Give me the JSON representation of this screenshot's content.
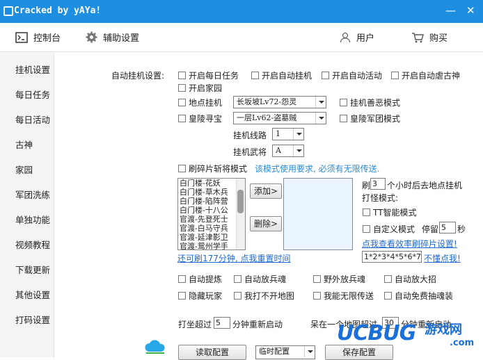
{
  "titlebar": {
    "title": "Cracked by yAYa!",
    "min": "—",
    "close": "✕"
  },
  "toolbar": {
    "console": "控制台",
    "assist": "辅助设置",
    "user": "用户",
    "buy": "购买"
  },
  "sidebar": {
    "items": [
      "挂机设置",
      "每日任务",
      "每日活动",
      "古神",
      "家园",
      "军团洗练",
      "单独功能",
      "视频教程",
      "下载更新",
      "其他设置",
      "打码设置"
    ]
  },
  "settings": {
    "heading": "自动挂机设置:",
    "row1": [
      "开启每日任务",
      "开启自动挂机",
      "开启自动活动",
      "开启自动虐古神"
    ],
    "home": "开启家园",
    "spot": "地点挂机",
    "spot_value": "长坂坡Lv72-怨灵",
    "evil_mode": "挂机善恶模式",
    "tomb": "皇陵寻宝",
    "tomb_value": "一层Lv62-盗墓贼",
    "tomb_legion": "皇陵军团模式",
    "line_label": "挂机线路",
    "line_value": "1",
    "general_label": "挂机武将",
    "general_value": "A",
    "shard_mode": "刷碎片斩将模式",
    "shard_note": "该模式使用要求, 必须有无限传送."
  },
  "list": {
    "items": [
      "白门楼-花妖",
      "白门楼-草木兵",
      "白门楼-陷阵营",
      "白门楼-十八公",
      "官渡-先登死士",
      "官渡-白马守兵",
      "官渡-延津影卫",
      "官渡-鸳州学手"
    ],
    "add": "添加>",
    "delete": "删除>"
  },
  "right": {
    "refresh_a": "刷",
    "refresh_hours": "3",
    "refresh_b": "个小时后去地点挂机",
    "mode_label": "打怪模式:",
    "tt": "TT智能模式",
    "custom": "自定义模式",
    "stay_label": "停留",
    "stay_value": "5",
    "stay_unit": "秒",
    "link_eff": "点我查看效率刷碎片设置!",
    "keys": "1*2*3*4*5*6*7",
    "link_help": "不懂点我!"
  },
  "link_reset": "还可刷177分钟, 点我重置时间",
  "checks2": [
    [
      "自动提炼",
      "自动放兵魂",
      "野外放兵魂",
      "自动放大招"
    ],
    [
      "隐藏玩家",
      "我打不开地图",
      "我能无限传送",
      "自动免费抽魂装"
    ]
  ],
  "idle": {
    "a": "打坐超过",
    "value": "5",
    "b": "分钟重新启动",
    "c": "呆在一个地图超过",
    "value2": "30",
    "d": "分钟重新启动"
  },
  "bottom": {
    "read": "读取配置",
    "select": "临时配置",
    "save": "保存配置"
  },
  "watermark": {
    "brand": "UCBUG",
    "cn": "游戏网",
    "url": ".com"
  },
  "colors": {
    "titlebar": "#1e8fe0",
    "link": "#1e6ad1",
    "note": "#2a8bd8",
    "watermark": "#1a6fd8"
  }
}
